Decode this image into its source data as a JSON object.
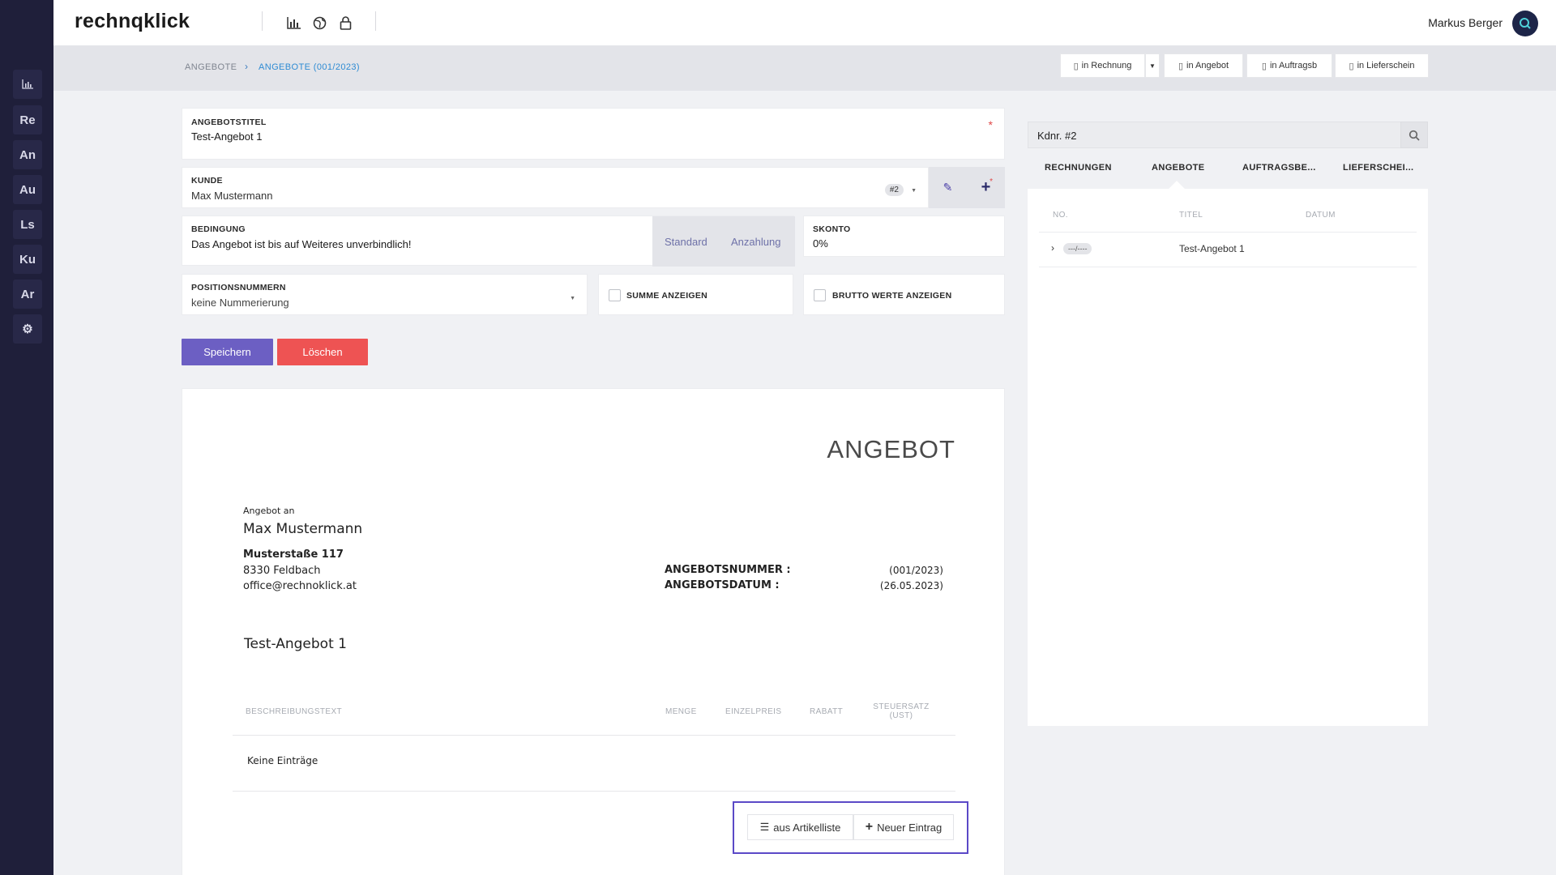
{
  "sidebar": {
    "items": [
      {
        "icon": "chart-icon",
        "label": ""
      },
      {
        "label": "Re"
      },
      {
        "label": "An"
      },
      {
        "label": "Au"
      },
      {
        "label": "Ls"
      },
      {
        "label": "Ku"
      },
      {
        "label": "Ar"
      },
      {
        "icon": "gear-icon",
        "label": ""
      }
    ]
  },
  "topbar": {
    "logo": "rechnqklick",
    "icons": [
      "bar-chart-icon",
      "globe-icon",
      "lock-icon"
    ],
    "user_name": "Markus Berger"
  },
  "breadcrumb": {
    "parent": "ANGEBOTE",
    "current": "ANGEBOTE (001/2023)"
  },
  "convert_buttons": {
    "rechnung": "in Rechnung",
    "angebot": "in Angebot",
    "auftragsb": "in Auftragsb",
    "lieferschein": "in Lieferschein"
  },
  "form": {
    "angebotstitel_label": "ANGEBOTSTITEL",
    "angebotstitel_value": "Test-Angebot 1",
    "required_mark": "*",
    "kunde_label": "KUNDE",
    "kunde_value": "Max Mustermann",
    "kunde_badge": "#2",
    "bedingung_label": "BEDINGUNG",
    "bedingung_value": "Das Angebot ist bis auf Weiteres unverbindlich!",
    "bedingung_options": [
      "Standard",
      "Anzahlung"
    ],
    "skonto_label": "SKONTO",
    "skonto_value": "0%",
    "positionsnummern_label": "POSITIONSNUMMERN",
    "positionsnummern_value": "keine Nummerierung",
    "summe_label": "SUMME ANZEIGEN",
    "brutto_label": "BRUTTO WERTE ANZEIGEN",
    "save_label": "Speichern",
    "delete_label": "Löschen"
  },
  "document": {
    "heading": "ANGEBOT",
    "to_label": "Angebot an",
    "customer_name": "Max Mustermann",
    "street": "Musterstaße 117",
    "city": "8330 Feldbach",
    "email": "office@rechnoklick.at",
    "number_label": "ANGEBOTSNUMMER :",
    "number_value": "(001/2023)",
    "date_label": "ANGEBOTSDATUM :",
    "date_value": "(26.05.2023)",
    "title": "Test-Angebot 1",
    "columns": {
      "description": "BESCHREIBUNGSTEXT",
      "quantity": "MENGE",
      "unit_price": "EINZELPREIS",
      "discount": "RABATT",
      "tax_line1": "STEUERSATZ",
      "tax_line2": "(UST)"
    },
    "empty_text": "Keine Einträge",
    "from_list_label": "aus Artikelliste",
    "new_entry_label": "Neuer Eintrag"
  },
  "right_panel": {
    "search_value": "Kdnr. #2",
    "tabs": [
      "RECHNUNGEN",
      "ANGEBOTE",
      "AUFTRAGSBE...",
      "LIEFERSCHEI..."
    ],
    "columns": {
      "no": "NO.",
      "title": "TITEL",
      "date": "DATUM"
    },
    "rows": [
      {
        "no": "---/----",
        "title": "Test-Angebot 1",
        "date": ""
      }
    ]
  },
  "colors": {
    "sidebar_bg": "#1f1f3a",
    "primary": "#6c5fc3",
    "danger": "#ee5353",
    "link": "#2e8bd3",
    "highlight": "#5b49c7"
  }
}
